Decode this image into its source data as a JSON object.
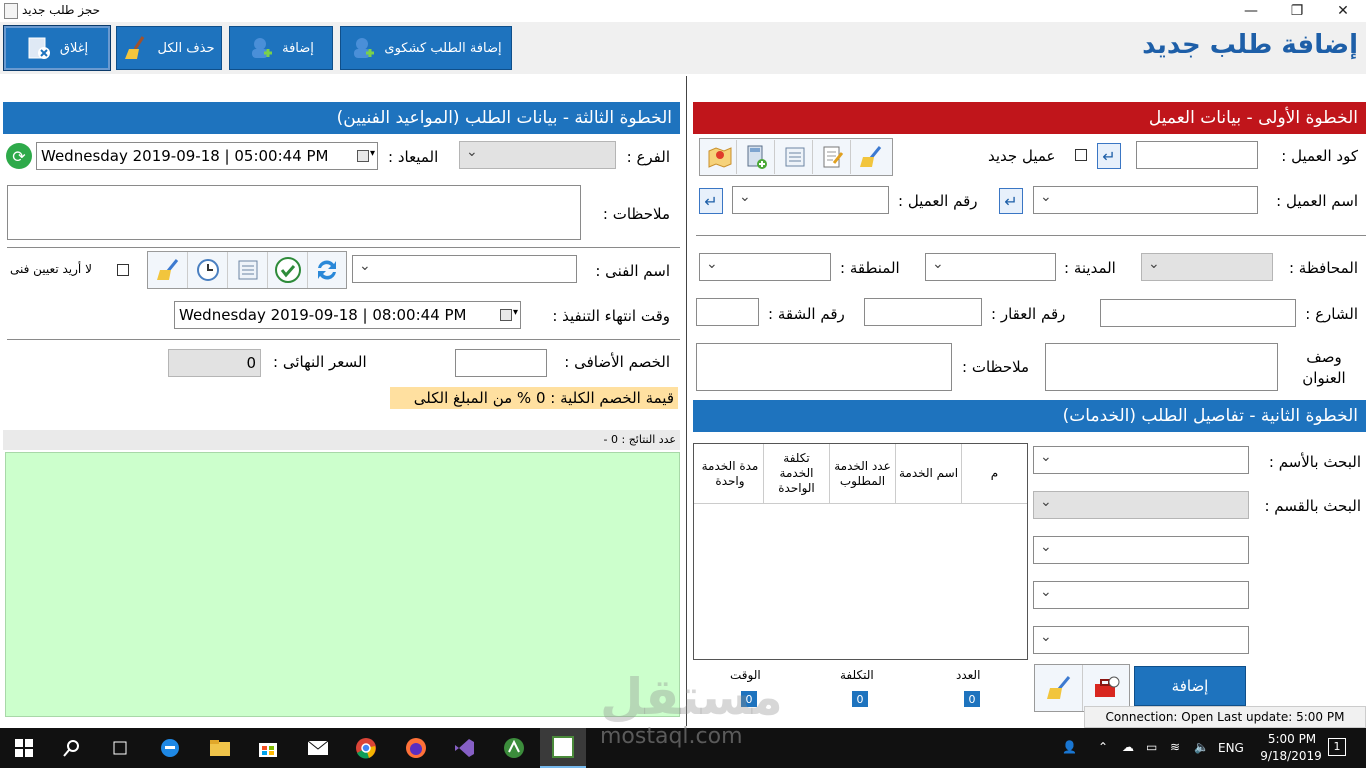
{
  "window": {
    "title": "حجز طلب جديد",
    "controls": {
      "minimize": "—",
      "maximize": "❐",
      "close": "✕"
    }
  },
  "toolbar": {
    "close": "إغلاق",
    "clear_all": "حذف الكل",
    "add": "إضافة",
    "add_statement": "إضافة الطلب كشكوى"
  },
  "page_title": "إضافة طلب جديد",
  "step1": {
    "header": "الخطوة الأولى - بيانات العميل",
    "client_code_label": "كود العميل :",
    "client_code_value": "",
    "new_client_label": "عميل جديد",
    "new_client_checked": false,
    "client_name_label": "اسم العميل :",
    "client_name_value": "",
    "client_number_label": "رقم العميل :",
    "client_number_value": "",
    "governorate_label": "المحافظة :",
    "city_label": "المدينة :",
    "area_label": "المنطقة :",
    "street_label": "الشارع :",
    "building_label": "رقم العقار :",
    "apartment_label": "رقم الشقة :",
    "address_desc_label": "وصف العنوان",
    "notes_label": "ملاحظات :"
  },
  "step2": {
    "header": "الخطوة الثانية  - تفاصيل الطلب (الخدمات)",
    "search_name_label": "البحث بالأسم :",
    "search_dept_label": "البحث بالقسم :",
    "columns": [
      "م",
      "اسم الخدمة",
      "عدد الخدمة المطلوب",
      "تكلفة الخدمة الواحدة",
      "مدة الخدمة واحدة"
    ],
    "add_button": "إضافة",
    "totals": {
      "count_label": "العدد",
      "count_value": "0",
      "cost_label": "التكلفة",
      "cost_value": "0",
      "time_label": "الوقت",
      "time_value": "0"
    }
  },
  "step3": {
    "header": "الخطوة الثالثة - بيانات الطلب (المواعيد  الفنيين)",
    "branch_label": "الفرع :",
    "appointment_label": "الميعاد :",
    "appointment_value": "Wednesday 2019-09-18 | 05:00:44  PM",
    "notes_label": "ملاحظات :",
    "tech_label": "اسم الفنى :",
    "no_tech_label": "لا أريد تعيين فنى",
    "no_tech_checked": false,
    "end_time_label": "وقت انتهاء التنفيذ :",
    "end_time_value": "Wednesday 2019-09-18 | 08:00:44  PM",
    "extra_discount_label": "الخصم الأضافى :",
    "extra_discount_value": "",
    "final_price_label": "السعر النهائى :",
    "final_price_value": "0",
    "discount_summary": "قيمة الخصم الكلية : 0 % من المبلغ الكلى",
    "results_label": "عدد النتائج : 0  -"
  },
  "status": {
    "connection": "Connection: Open Last update: 5:00 PM"
  },
  "watermark": {
    "ar": "مستقل",
    "en": "mostaql.com"
  },
  "taskbar": {
    "time": "5:00 PM",
    "date": "9/18/2019",
    "lang": "ENG",
    "notifications": "1"
  },
  "colors": {
    "accent": "#1e73be",
    "step1_header": "#c0151b",
    "results_bg": "#ccffcc",
    "discount_bg": "#ffe0a0"
  }
}
